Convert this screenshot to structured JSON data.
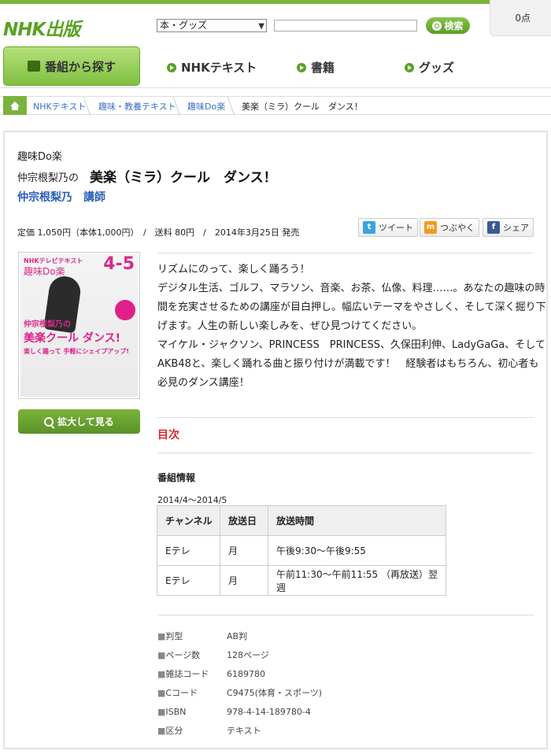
{
  "header": {
    "logo_text": "NHK出版",
    "category_select": "本・グッズ",
    "search_button": "検索",
    "cart_points": "0点"
  },
  "nav": {
    "main_button": "番組から探す",
    "items": [
      "NHKテキスト",
      "書籍",
      "グッズ"
    ]
  },
  "breadcrumb": [
    "NHKテキスト",
    "趣味・教養テキスト",
    "趣味Do楽",
    "美楽（ミラ）クール　ダンス！"
  ],
  "product": {
    "series": "趣味Do楽",
    "title_prefix": "仲宗根梨乃の",
    "title_main": "美楽（ミラ）クール　ダンス！",
    "author": "仲宗根梨乃　講師",
    "price_line": "定価 1,050円（本体1,000円）　/　送料 80円　/　2014年3月25日 発売"
  },
  "share": {
    "tweet": "ツイート",
    "mutter": "つぶやく",
    "fb_share": "シェア"
  },
  "cover": {
    "top_label": "NHKテレビテキスト",
    "issue_number": "4-5",
    "series_label": "趣味Do楽",
    "name_label": "仲宗根梨乃の",
    "title_label": "美楽クール ダンス!",
    "subtitle_label": "楽しく踊って 手軽にシェイプアップ!"
  },
  "zoom_button": "拡大して見る",
  "description": [
    "リズムにのって、楽しく踊ろう！",
    "デジタル生活、ゴルフ、マラソン、音楽、お茶、仏像、料理……。あなたの趣味の時",
    "間を充実させるための講座が目白押し。幅広いテーマをやさしく、そして深く掘り下",
    "げます。人生の新しい楽しみを、ぜひ見つけてください。",
    "マイケル・ジャクソン、PRINCESS　PRINCESS、久保田利伸、LadyGaGa、そして",
    "AKB48と、楽しく踊れる曲と振り付けが満載です！　経験者はもちろん、初心者も",
    "必見のダンス講座！"
  ],
  "toc_label": "目次",
  "program": {
    "label": "番組情報",
    "period": "2014/4～2014/5",
    "headers": [
      "チャンネル",
      "放送日",
      "放送時間"
    ],
    "rows": [
      [
        "Eテレ",
        "月",
        "午後9:30～午後9:55"
      ],
      [
        "Eテレ",
        "月",
        "午前11:30～午前11:55 （再放送）翌週"
      ]
    ]
  },
  "specs": [
    {
      "key": "判型",
      "value": "AB判"
    },
    {
      "key": "ページ数",
      "value": "128ページ"
    },
    {
      "key": "雑誌コード",
      "value": "6189780"
    },
    {
      "key": "Cコード",
      "value": "C9475(体育・スポーツ)"
    },
    {
      "key": "ISBN",
      "value": "978-4-14-189780-4"
    },
    {
      "key": "区分",
      "value": "テキスト"
    }
  ],
  "colors": {
    "brand_green": "#5aa224",
    "link_blue": "#2a5db8",
    "toc_red": "#d8262b"
  }
}
